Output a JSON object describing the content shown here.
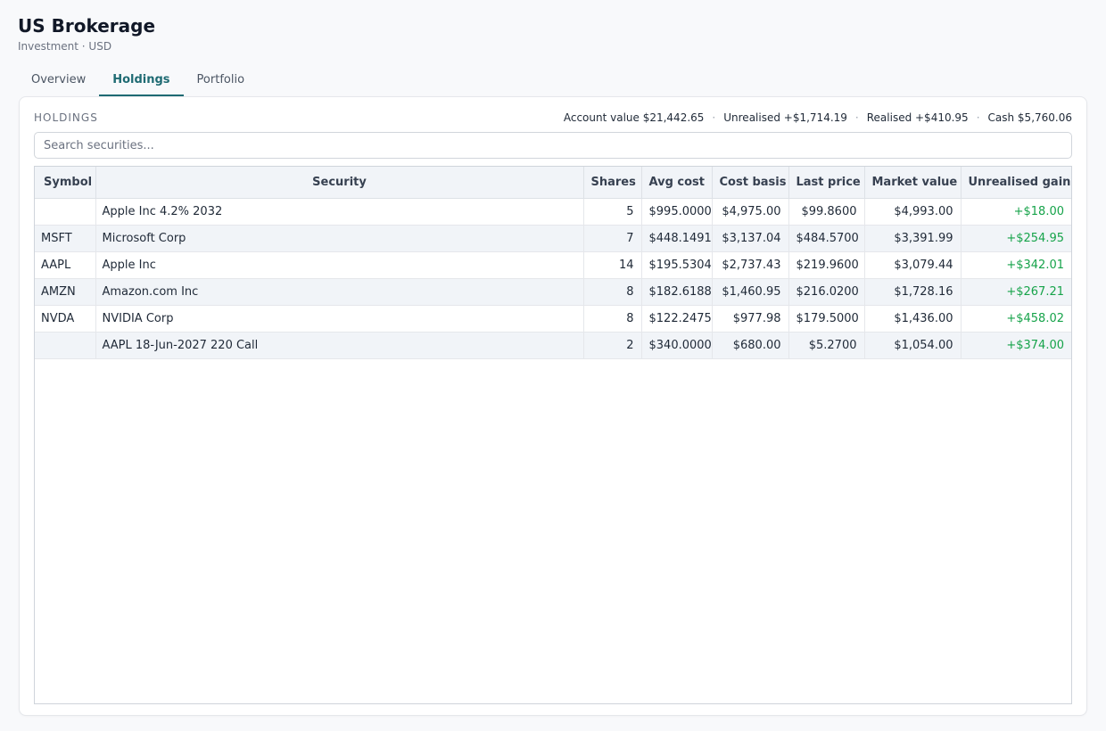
{
  "account": {
    "title": "US Brokerage",
    "subtitle": "Investment · USD"
  },
  "tabs": [
    {
      "label": "Overview",
      "active": false
    },
    {
      "label": "Holdings",
      "active": true
    },
    {
      "label": "Portfolio",
      "active": false
    }
  ],
  "holdings": {
    "section_label": "HOLDINGS",
    "stats": {
      "account_value": "Account value $21,442.65",
      "unrealised": "Unrealised +$1,714.19",
      "realised": "Realised +$410.95",
      "cash": "Cash $5,760.06",
      "separator": "·"
    },
    "search": {
      "placeholder": "Search securities...",
      "value": ""
    },
    "columns": [
      "Symbol",
      "Security",
      "Shares",
      "Avg cost",
      "Cost basis",
      "Last price",
      "Market value",
      "Unrealised gain"
    ],
    "rows": [
      [
        "",
        "Apple Inc 4.2% 2032",
        "5",
        "$995.0000",
        "$4,975.00",
        "$99.8600",
        "$4,993.00",
        "+$18.00"
      ],
      [
        "MSFT",
        "Microsoft Corp",
        "7",
        "$448.1491",
        "$3,137.04",
        "$484.5700",
        "$3,391.99",
        "+$254.95"
      ],
      [
        "AAPL",
        "Apple Inc",
        "14",
        "$195.5304",
        "$2,737.43",
        "$219.9600",
        "$3,079.44",
        "+$342.01"
      ],
      [
        "AMZN",
        "Amazon.com Inc",
        "8",
        "$182.6188",
        "$1,460.95",
        "$216.0200",
        "$1,728.16",
        "+$267.21"
      ],
      [
        "NVDA",
        "NVIDIA Corp",
        "8",
        "$122.2475",
        "$977.98",
        "$179.5000",
        "$1,436.00",
        "+$458.02"
      ],
      [
        "",
        "AAPL 18-Jun-2027 220 Call",
        "2",
        "$340.0000",
        "$680.00",
        "$5.2700",
        "$1,054.00",
        "+$374.00"
      ]
    ]
  },
  "colors": {
    "accent": "#1f6b73",
    "gain": "#16a34a",
    "header_bg": "#f1f4f8"
  }
}
